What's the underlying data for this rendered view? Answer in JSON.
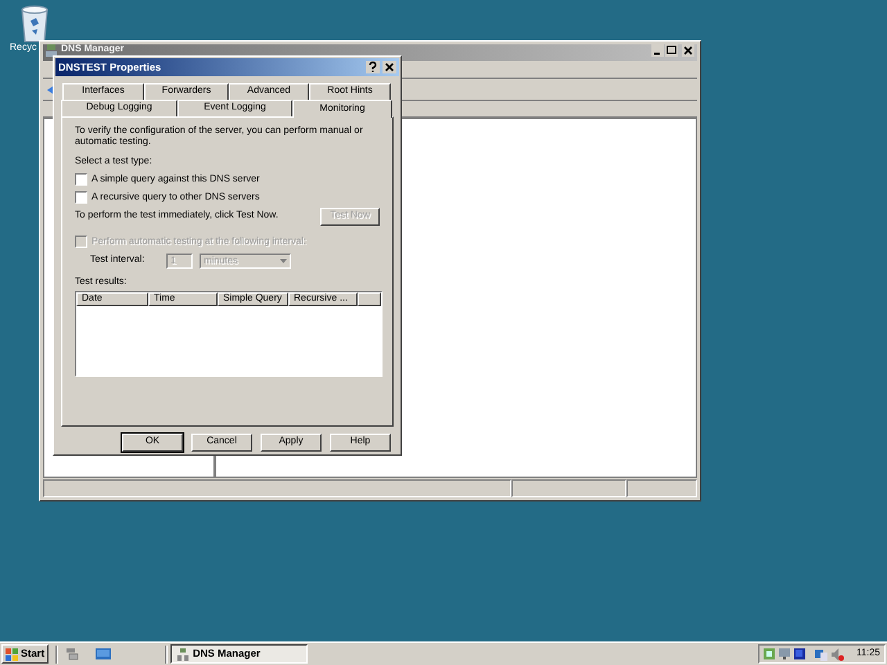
{
  "desktop": {
    "icons": [
      {
        "label": "Recyc"
      }
    ]
  },
  "main_window": {
    "title": "DNS Manager"
  },
  "dialog": {
    "title": "DNSTEST Properties",
    "tab_rows": [
      [
        {
          "label": "Interfaces",
          "selected": false
        },
        {
          "label": "Forwarders",
          "selected": false
        },
        {
          "label": "Advanced",
          "selected": false
        },
        {
          "label": "Root Hints",
          "selected": false
        }
      ],
      [
        {
          "label": "Debug Logging",
          "selected": false
        },
        {
          "label": "Event Logging",
          "selected": false
        },
        {
          "label": "Monitoring",
          "selected": true
        }
      ]
    ],
    "intro": "To verify the configuration of the server, you can perform manual or automatic testing.",
    "test_type_label": "Select a test type:",
    "test_types": [
      {
        "label": "A simple query against this DNS server",
        "checked": false
      },
      {
        "label": "A recursive query to other DNS servers",
        "checked": false
      }
    ],
    "test_now_text": "To perform the test immediately, click Test Now.",
    "test_now_button": {
      "label": "Test Now",
      "disabled": true
    },
    "automatic": {
      "label": "Perform automatic testing at the following interval:",
      "checked": false,
      "disabled": true
    },
    "interval": {
      "label": "Test interval:",
      "value": "1",
      "unit": "minutes",
      "disabled": true
    },
    "results": {
      "label": "Test results:",
      "columns": [
        "Date",
        "Time",
        "Simple Query",
        "Recursive ..."
      ]
    },
    "buttons": [
      {
        "label": "OK",
        "default": true
      },
      {
        "label": "Cancel",
        "default": false
      },
      {
        "label": "Apply",
        "default": false
      },
      {
        "label": "Help",
        "default": false
      }
    ]
  },
  "taskbar": {
    "start": "Start",
    "tasks": [
      {
        "label": "DNS Manager",
        "selected": true
      }
    ],
    "clock": "11:25"
  }
}
